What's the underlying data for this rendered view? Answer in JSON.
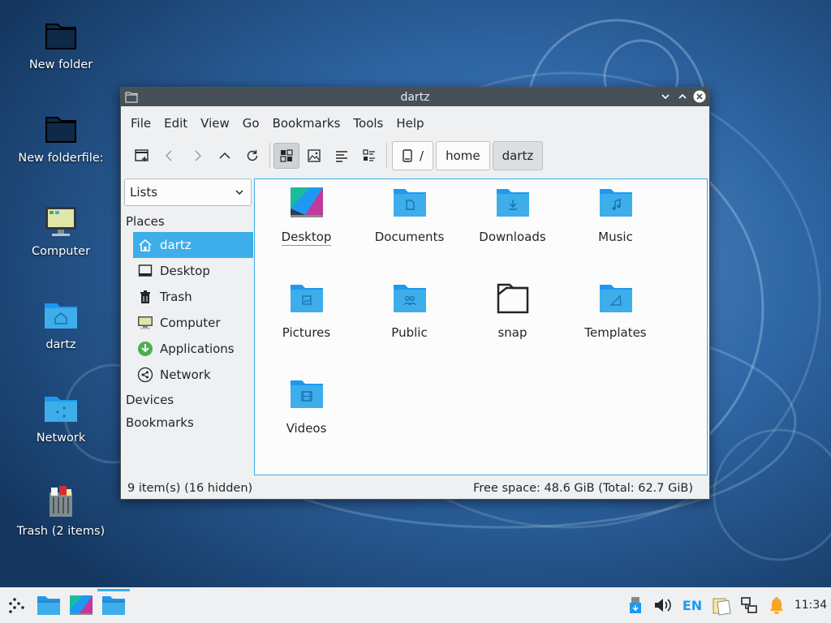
{
  "desktop": {
    "icons": [
      {
        "label": "New folder",
        "icon": "folder-dark-icon"
      },
      {
        "label": "New folderfile:",
        "icon": "folder-dark-icon"
      },
      {
        "label": "Computer",
        "icon": "computer-icon"
      },
      {
        "label": "dartz",
        "icon": "home-folder-icon"
      },
      {
        "label": "Network",
        "icon": "network-folder-icon"
      },
      {
        "label": "Trash (2 items)",
        "icon": "trash-full-icon"
      }
    ]
  },
  "window": {
    "title": "dartz",
    "menus": [
      "File",
      "Edit",
      "View",
      "Go",
      "Bookmarks",
      "Tools",
      "Help"
    ],
    "breadcrumb": [
      "/",
      "home",
      "dartz"
    ],
    "side_pane": {
      "mode": "Lists",
      "places_header": "Places",
      "places": [
        {
          "label": "dartz",
          "icon": "home-icon",
          "selected": true
        },
        {
          "label": "Desktop",
          "icon": "desktop-icon"
        },
        {
          "label": "Trash",
          "icon": "trash-icon"
        },
        {
          "label": "Computer",
          "icon": "computer-icon"
        },
        {
          "label": "Applications",
          "icon": "applications-icon"
        },
        {
          "label": "Network",
          "icon": "network-icon"
        }
      ],
      "devices_header": "Devices",
      "bookmarks_header": "Bookmarks"
    },
    "files": [
      {
        "name": "Desktop",
        "icon": "desktop-folder-icon"
      },
      {
        "name": "Documents",
        "icon": "documents-folder-icon"
      },
      {
        "name": "Downloads",
        "icon": "downloads-folder-icon"
      },
      {
        "name": "Music",
        "icon": "music-folder-icon"
      },
      {
        "name": "Pictures",
        "icon": "pictures-folder-icon"
      },
      {
        "name": "Public",
        "icon": "public-folder-icon"
      },
      {
        "name": "snap",
        "icon": "folder-outline-icon"
      },
      {
        "name": "Templates",
        "icon": "templates-folder-icon"
      },
      {
        "name": "Videos",
        "icon": "videos-folder-icon"
      }
    ],
    "status": {
      "items": "9 item(s) (16 hidden)",
      "free_space": "Free space: 48.6 GiB (Total: 62.7 GiB)"
    }
  },
  "taskbar": {
    "language": "EN",
    "clock": "11:34"
  },
  "colors": {
    "accent": "#3daee9",
    "folder": "#3daee9",
    "titlebar": "#475057"
  }
}
